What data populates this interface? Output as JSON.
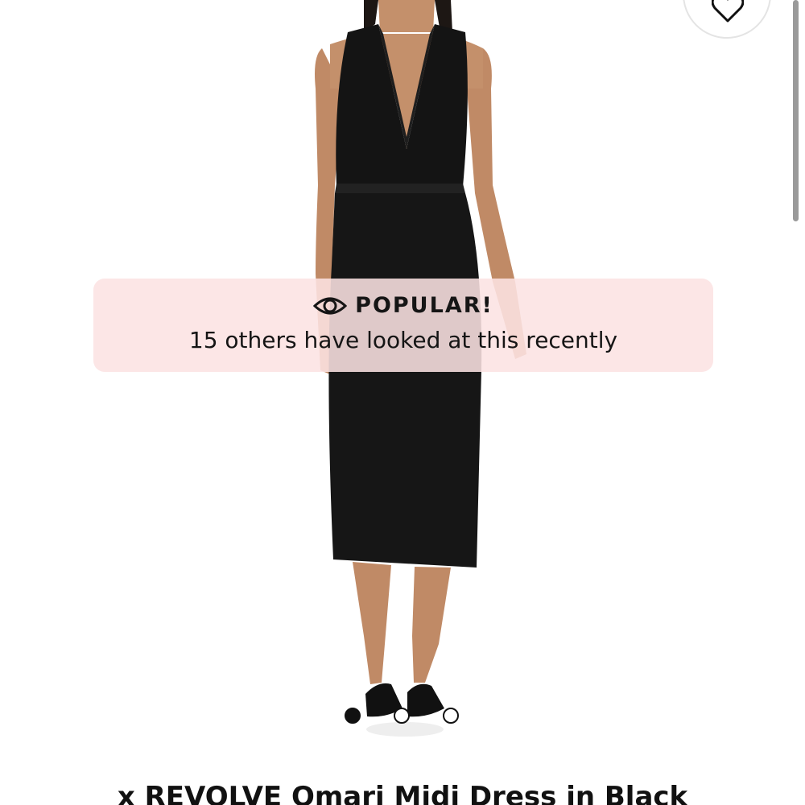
{
  "product": {
    "image_alt": "Black halter midi dress",
    "title": "x REVOLVE Omari Midi Dress in Black"
  },
  "wishlist": {
    "icon": "heart-icon"
  },
  "banner": {
    "icon": "eye-icon",
    "title": "POPULAR!",
    "text": "15 others have looked at this recently",
    "background": "#fce2e2"
  },
  "carousel": {
    "total": 3,
    "active_index": 0
  }
}
